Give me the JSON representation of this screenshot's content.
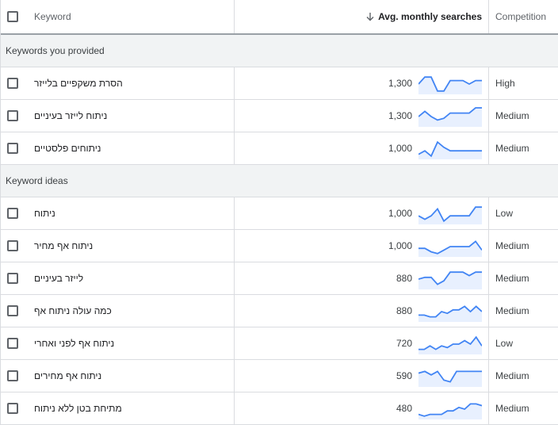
{
  "header": {
    "keyword": "Keyword",
    "avg": "Avg. monthly searches",
    "competition": "Competition"
  },
  "sections": [
    {
      "title": "Keywords you provided",
      "rows": [
        {
          "keyword": "הסרת משקפיים בלייזר",
          "avg": "1,300",
          "competition": "High",
          "trend": [
            0.5,
            0.9,
            0.9,
            0.1,
            0.1,
            0.7,
            0.7,
            0.7,
            0.5,
            0.7,
            0.7
          ]
        },
        {
          "keyword": "ניתוח לייזר בעיניים",
          "avg": "1,300",
          "competition": "Medium",
          "trend": [
            0.5,
            0.8,
            0.5,
            0.3,
            0.4,
            0.7,
            0.7,
            0.7,
            0.7,
            1.0,
            1.0
          ]
        },
        {
          "keyword": "ניתוחים פלסטיים",
          "avg": "1,000",
          "competition": "Medium",
          "trend": [
            0.2,
            0.4,
            0.1,
            0.9,
            0.6,
            0.4,
            0.4,
            0.4,
            0.4,
            0.4,
            0.4
          ]
        }
      ]
    },
    {
      "title": "Keyword ideas",
      "rows": [
        {
          "keyword": "ניתוח",
          "avg": "1,000",
          "competition": "Low",
          "trend": [
            0.4,
            0.2,
            0.4,
            0.8,
            0.1,
            0.4,
            0.4,
            0.4,
            0.4,
            0.9,
            0.9
          ]
        },
        {
          "keyword": "ניתוח אף מחיר",
          "avg": "1,000",
          "competition": "Medium",
          "trend": [
            0.4,
            0.4,
            0.2,
            0.1,
            0.3,
            0.5,
            0.5,
            0.5,
            0.5,
            0.8,
            0.3
          ]
        },
        {
          "keyword": "לייזר בעיניים",
          "avg": "880",
          "competition": "Medium",
          "trend": [
            0.5,
            0.6,
            0.6,
            0.2,
            0.4,
            0.9,
            0.9,
            0.9,
            0.7,
            0.9,
            0.9
          ]
        },
        {
          "keyword": "כמה עולה ניתוח אף",
          "avg": "880",
          "competition": "Medium",
          "trend": [
            0.3,
            0.3,
            0.2,
            0.2,
            0.5,
            0.4,
            0.6,
            0.6,
            0.8,
            0.5,
            0.8,
            0.5
          ]
        },
        {
          "keyword": "ניתוח אף לפני ואחרי",
          "avg": "720",
          "competition": "Low",
          "trend": [
            0.2,
            0.2,
            0.4,
            0.2,
            0.4,
            0.3,
            0.5,
            0.5,
            0.7,
            0.5,
            0.9,
            0.4
          ]
        },
        {
          "keyword": "ניתוח אף מחירים",
          "avg": "590",
          "competition": "Medium",
          "trend": [
            0.7,
            0.8,
            0.6,
            0.8,
            0.3,
            0.2,
            0.8,
            0.8,
            0.8,
            0.8,
            0.8
          ]
        },
        {
          "keyword": "מתיחת בטן ללא ניתוח",
          "avg": "480",
          "competition": "Medium",
          "trend": [
            0.2,
            0.1,
            0.2,
            0.2,
            0.2,
            0.4,
            0.4,
            0.6,
            0.5,
            0.8,
            0.8,
            0.7
          ]
        }
      ]
    }
  ],
  "colors": {
    "line": "#4285f4",
    "fill": "#e8f0fe"
  }
}
